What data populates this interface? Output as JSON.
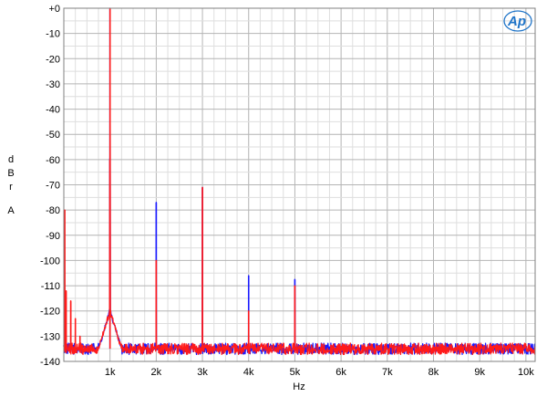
{
  "logo": {
    "text": "Ap",
    "color": "#1f74c8"
  },
  "chart_data": {
    "type": "line",
    "xlabel": "Hz",
    "ylabel_letters": [
      "d",
      "B",
      "r",
      "",
      "A"
    ],
    "xlim": [
      0,
      10200
    ],
    "ylim": [
      -140,
      0
    ],
    "grid": true,
    "xticks": [
      {
        "value": 1000,
        "label": "1k"
      },
      {
        "value": 2000,
        "label": "2k"
      },
      {
        "value": 3000,
        "label": "3k"
      },
      {
        "value": 4000,
        "label": "4k"
      },
      {
        "value": 5000,
        "label": "5k"
      },
      {
        "value": 6000,
        "label": "6k"
      },
      {
        "value": 7000,
        "label": "7k"
      },
      {
        "value": 8000,
        "label": "8k"
      },
      {
        "value": 9000,
        "label": "9k"
      },
      {
        "value": 10000,
        "label": "10k"
      }
    ],
    "yticks": [
      {
        "value": 0,
        "label": "+0"
      },
      {
        "value": -10,
        "label": "-10"
      },
      {
        "value": -20,
        "label": "-20"
      },
      {
        "value": -30,
        "label": "-30"
      },
      {
        "value": -40,
        "label": "-40"
      },
      {
        "value": -50,
        "label": "-50"
      },
      {
        "value": -60,
        "label": "-60"
      },
      {
        "value": -70,
        "label": "-70"
      },
      {
        "value": -80,
        "label": "-80"
      },
      {
        "value": -90,
        "label": "-90"
      },
      {
        "value": -100,
        "label": "-100"
      },
      {
        "value": -110,
        "label": "-110"
      },
      {
        "value": -120,
        "label": "-120"
      },
      {
        "value": -130,
        "label": "-130"
      },
      {
        "value": -140,
        "label": "-140"
      }
    ],
    "noise_floor": -135,
    "series": [
      {
        "color": "#1a1aff",
        "peaks": [
          {
            "x": 1000,
            "y": 0
          },
          {
            "x": 2000,
            "y": -77
          },
          {
            "x": 3000,
            "y": -71
          },
          {
            "x": 4000,
            "y": -106
          },
          {
            "x": 5000,
            "y": -107.5
          }
        ]
      },
      {
        "color": "#ff1a1a",
        "peaks": [
          {
            "x": 20,
            "y": -80
          },
          {
            "x": 50,
            "y": -112
          },
          {
            "x": 150,
            "y": -116
          },
          {
            "x": 250,
            "y": -123
          },
          {
            "x": 350,
            "y": -130
          },
          {
            "x": 1000,
            "y": 0
          },
          {
            "x": 2000,
            "y": -100
          },
          {
            "x": 3000,
            "y": -71
          },
          {
            "x": 4000,
            "y": -120
          },
          {
            "x": 5000,
            "y": -110
          }
        ]
      }
    ]
  }
}
